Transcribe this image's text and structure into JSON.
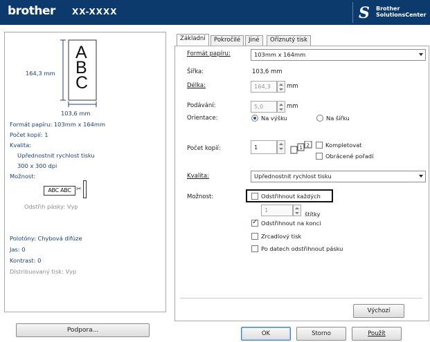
{
  "header": {
    "logo": "brother",
    "model": "XX-XXXX",
    "solutions_line1": "Brother",
    "solutions_line2": "SolutionsCenter"
  },
  "preview": {
    "height_dim": "164,3 mm",
    "width_dim": "103,6 mm",
    "sample_letters": "ABC",
    "cut_sample": "ABC ABC"
  },
  "summary": {
    "paper_format": "Formát papíru: 103mm x 164mm",
    "copies": "Počet kopií: 1",
    "quality_label": "Kvalita:",
    "quality_value": "Upřednostnit rychlost tisku",
    "resolution": "300 x 300 dpi",
    "options_label": "Možnost:",
    "tape_cut": "Odstřih pásky: Vyp",
    "halftone": "Polotóny: Chybová difúze",
    "brightness": "Jas:  0",
    "contrast": "Kontrast:  0",
    "distributed": "Distribuovaný tisk: Vyp"
  },
  "support_button": "Podpora...",
  "tabs": [
    "Základní",
    "Pokročilé",
    "Jiné",
    "Oříznutý tisk"
  ],
  "form": {
    "paper_format_label": "Formát papíru:",
    "paper_format_value": "103mm x 164mm",
    "width_label": "Šířka:",
    "width_value": "103,6 mm",
    "length_label": "Délka:",
    "length_value": "164,3",
    "length_unit": "mm",
    "feed_label": "Podávání:",
    "feed_value": "5,0",
    "feed_unit": "mm",
    "orientation_label": "Orientace:",
    "orientation_portrait": "Na výšku",
    "orientation_landscape": "Na šířku",
    "copies_label": "Počet kopií:",
    "copies_value": "1",
    "collate_label": "Kompletovat",
    "reverse_label": "Obrácené pořadí",
    "quality_label": "Kvalita:",
    "quality_value": "Upřednostnit rychlost tisku",
    "options_label": "Možnost:",
    "cut_every_label": "Odstřihnout každých",
    "cut_every_value": "1",
    "cut_every_unit": "štítky",
    "cut_end_label": "Odstřihnout na konci",
    "mirror_label": "Zrcadlový tisk",
    "cut_after_label": "Po datech odstřihnout pásku",
    "default_button": "Výchozí"
  },
  "footer": {
    "ok": "OK",
    "cancel": "Storno",
    "apply": "Použít"
  }
}
